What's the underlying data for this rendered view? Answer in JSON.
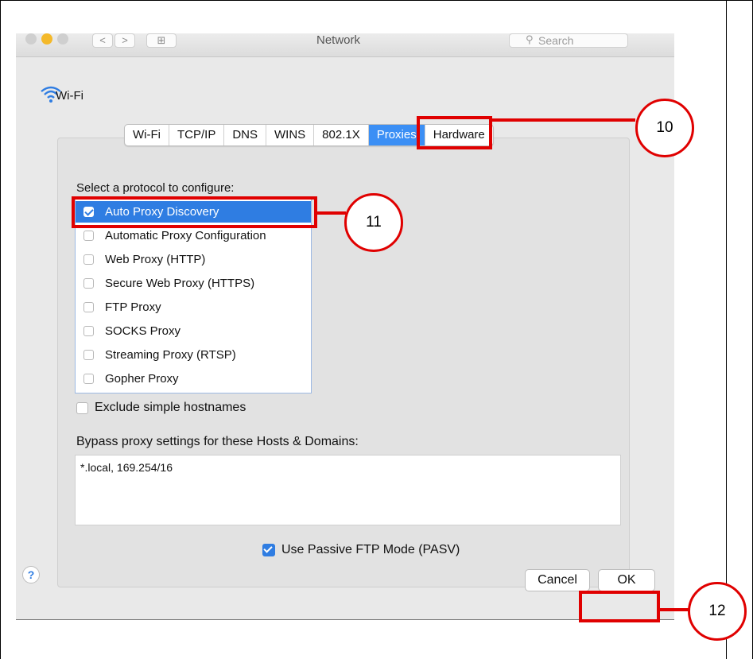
{
  "window": {
    "title": "Network",
    "search_placeholder": "Search",
    "nav_back": "<",
    "nav_forward": ">",
    "grid_glyph": "⊞"
  },
  "interface": {
    "icon": "wifi-icon",
    "name": "Wi-Fi"
  },
  "tabs": [
    {
      "label": "Wi-Fi",
      "active": false
    },
    {
      "label": "TCP/IP",
      "active": false
    },
    {
      "label": "DNS",
      "active": false
    },
    {
      "label": "WINS",
      "active": false
    },
    {
      "label": "802.1X",
      "active": false
    },
    {
      "label": "Proxies",
      "active": true
    },
    {
      "label": "Hardware",
      "active": false
    }
  ],
  "protocols": {
    "label": "Select a protocol to configure:",
    "items": [
      {
        "label": "Auto Proxy Discovery",
        "checked": true,
        "selected": true
      },
      {
        "label": "Automatic Proxy Configuration",
        "checked": false,
        "selected": false
      },
      {
        "label": "Web Proxy (HTTP)",
        "checked": false,
        "selected": false
      },
      {
        "label": "Secure Web Proxy (HTTPS)",
        "checked": false,
        "selected": false
      },
      {
        "label": "FTP Proxy",
        "checked": false,
        "selected": false
      },
      {
        "label": "SOCKS Proxy",
        "checked": false,
        "selected": false
      },
      {
        "label": "Streaming Proxy (RTSP)",
        "checked": false,
        "selected": false
      },
      {
        "label": "Gopher Proxy",
        "checked": false,
        "selected": false
      }
    ]
  },
  "exclude_simple_hostnames": {
    "label": "Exclude simple hostnames",
    "checked": false
  },
  "bypass": {
    "label": "Bypass proxy settings for these Hosts & Domains:",
    "value": "*.local, 169.254/16"
  },
  "passive_ftp": {
    "label": "Use Passive FTP Mode (PASV)",
    "checked": true
  },
  "buttons": {
    "help": "?",
    "cancel": "Cancel",
    "ok": "OK"
  },
  "callouts": {
    "tabs_step": "10",
    "list_step": "11",
    "ok_step": "12"
  },
  "colors": {
    "accent": "#2f7de2",
    "annotation": "#e00000"
  }
}
